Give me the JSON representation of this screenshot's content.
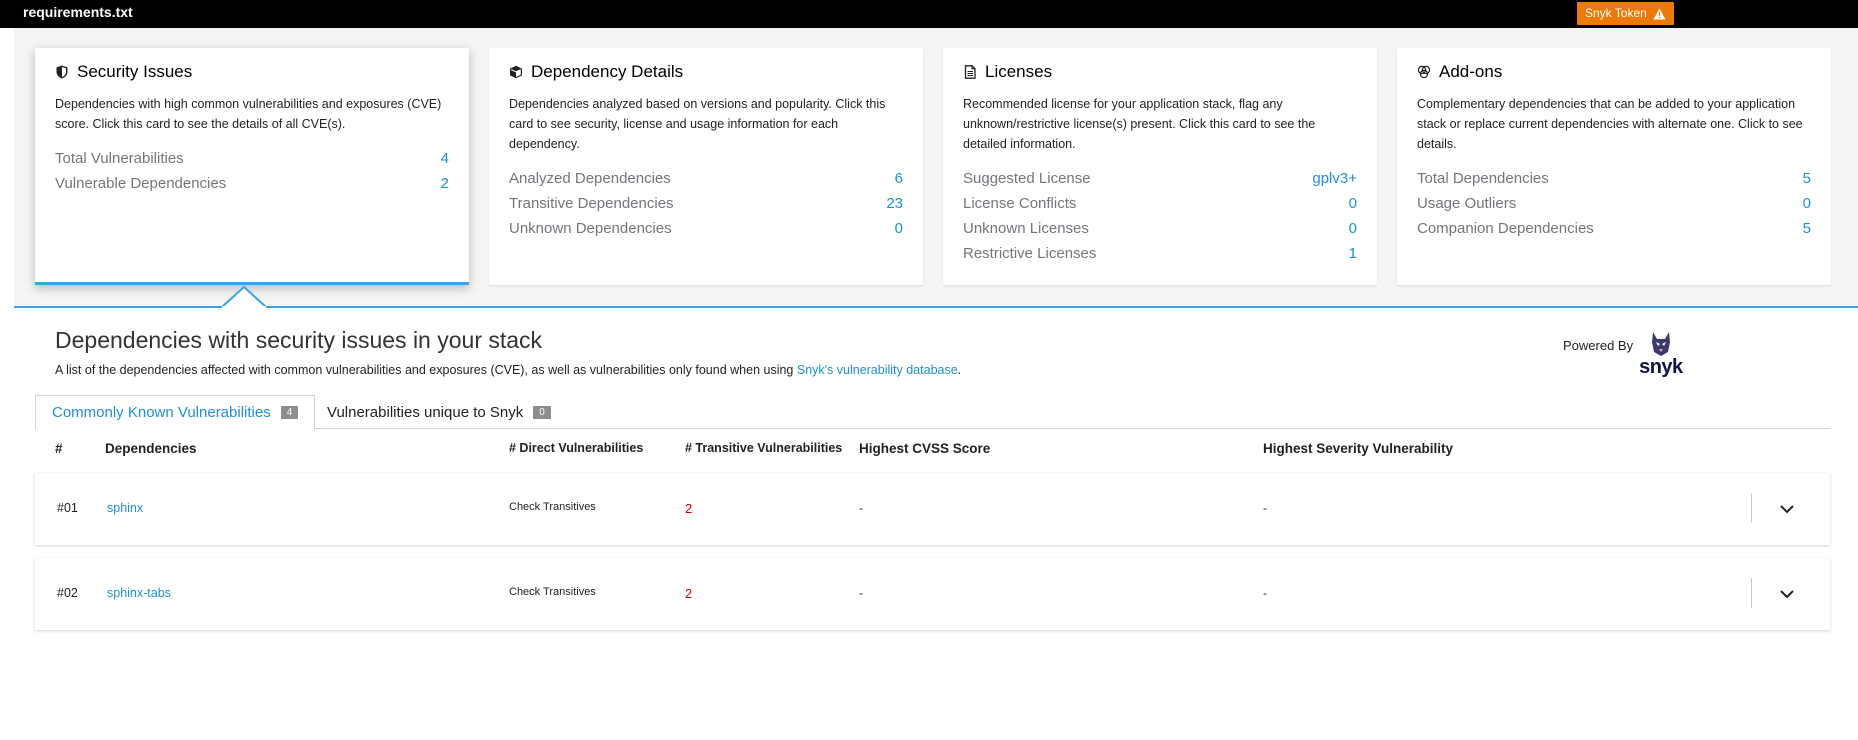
{
  "header": {
    "file_name": "requirements.txt",
    "snyk_token_label": "Snyk Token"
  },
  "cards": [
    {
      "title": "Security Issues",
      "icon": "shield-icon",
      "description": "Dependencies with high common vulnerabilities and exposures (CVE) score. Click this card to see the details of all CVE(s).",
      "rows": [
        {
          "label": "Total Vulnerabilities",
          "value": "4"
        },
        {
          "label": "Vulnerable Dependencies",
          "value": "2"
        }
      ]
    },
    {
      "title": "Dependency Details",
      "icon": "cube-icon",
      "description": "Dependencies analyzed based on versions and popularity. Click this card to see security, license and usage information for each dependency.",
      "rows": [
        {
          "label": "Analyzed Dependencies",
          "value": "6"
        },
        {
          "label": "Transitive Dependencies",
          "value": "23"
        },
        {
          "label": "Unknown Dependencies",
          "value": "0"
        }
      ]
    },
    {
      "title": "Licenses",
      "icon": "document-icon",
      "description": "Recommended license for your application stack, flag any unknown/restrictive license(s) present. Click this card to see the detailed information.",
      "rows": [
        {
          "label": "Suggested License",
          "value": "gplv3+"
        },
        {
          "label": "License Conflicts",
          "value": "0"
        },
        {
          "label": "Unknown Licenses",
          "value": "0"
        },
        {
          "label": "Restrictive Licenses",
          "value": "1"
        }
      ]
    },
    {
      "title": "Add-ons",
      "icon": "cubes-icon",
      "description": "Complementary dependencies that can be added to your application stack or replace current dependencies with alternate one. Click to see details.",
      "rows": [
        {
          "label": "Total Dependencies",
          "value": "5"
        },
        {
          "label": "Usage Outliers",
          "value": "0"
        },
        {
          "label": "Companion Dependencies",
          "value": "5"
        }
      ]
    }
  ],
  "section": {
    "title": "Dependencies with security issues in your stack",
    "description_prefix": "A list of the dependencies affected with common vulnerabilities and exposures (CVE), as well as vulnerabilities only found when using ",
    "description_link": "Snyk's vulnerability database",
    "description_suffix": ".",
    "powered_by": "Powered By",
    "snyk_word": "snyk"
  },
  "tabs": [
    {
      "label": "Commonly Known Vulnerabilities",
      "count": "4"
    },
    {
      "label": "Vulnerabilities unique to Snyk",
      "count": "0"
    }
  ],
  "table": {
    "columns": [
      "#",
      "Dependencies",
      "# Direct Vulnerabilities",
      "# Transitive Vulnerabilities",
      "Highest CVSS Score",
      "Highest Severity Vulnerability"
    ],
    "rows": [
      {
        "num": "#01",
        "dependency": "sphinx",
        "direct": "Check Transitives",
        "transitive": "2",
        "cvss": "-",
        "severity": "-"
      },
      {
        "num": "#02",
        "dependency": "sphinx-tabs",
        "direct": "Check Transitives",
        "transitive": "2",
        "cvss": "-",
        "severity": "-"
      }
    ]
  },
  "colors": {
    "accent": "#39a5dc",
    "link": "#1e90d0",
    "token_button": "#ec7a08",
    "danger": "#cc0000"
  }
}
